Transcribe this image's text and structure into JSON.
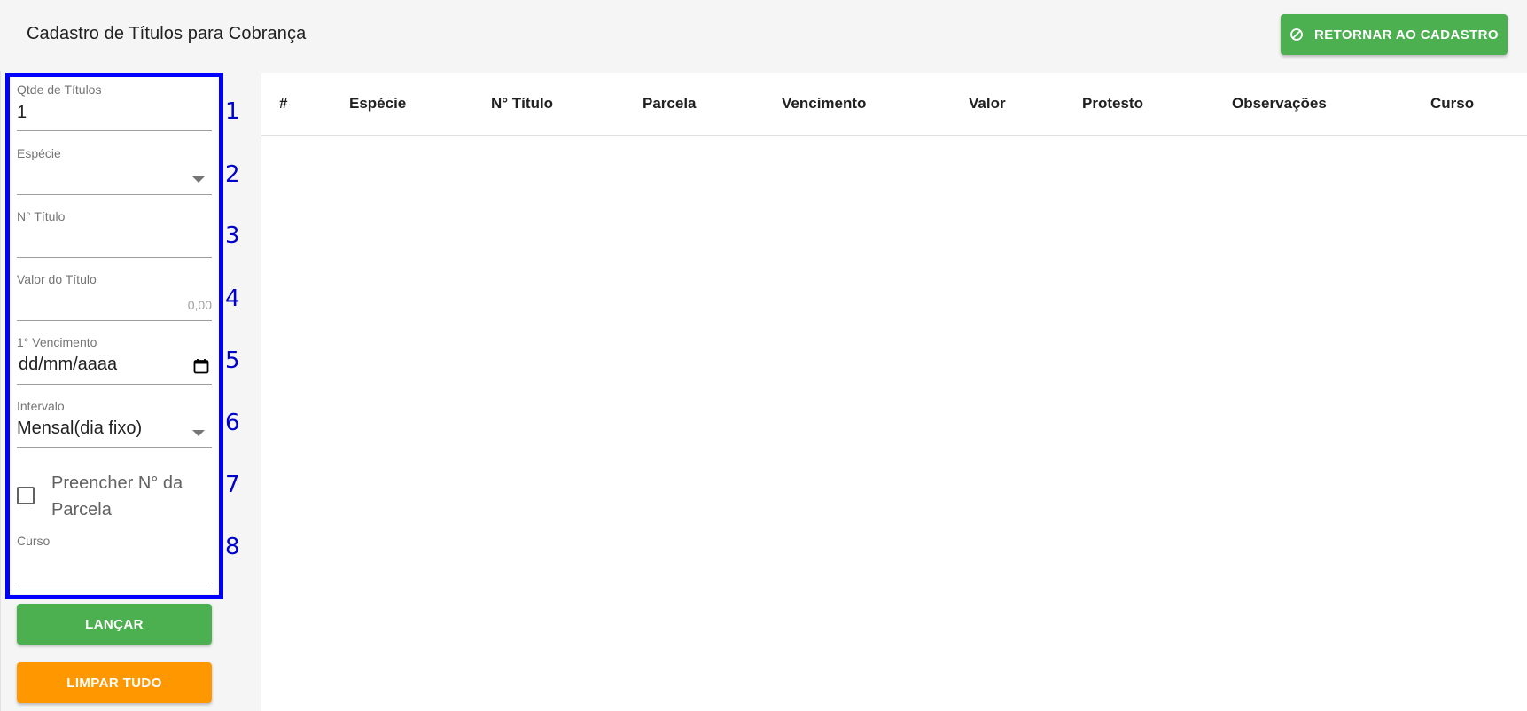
{
  "header": {
    "title": "Cadastro de Títulos para Cobrança",
    "return_button_label": "RETORNAR AO CADASTRO",
    "return_button_icon": "cancel-circle-icon"
  },
  "form": {
    "qtde": {
      "label": "Qtde de Títulos",
      "value": "1",
      "number": "1"
    },
    "especie": {
      "label": "Espécie",
      "value": "",
      "number": "2"
    },
    "numero_titulo": {
      "label": "N° Título",
      "value": "",
      "number": "3"
    },
    "valor": {
      "label": "Valor do Título",
      "placeholder": "0,00",
      "number": "4"
    },
    "vencimento": {
      "label": "1° Vencimento",
      "value": "dd/mm/aaaa",
      "number": "5"
    },
    "intervalo": {
      "label": "Intervalo",
      "value": "Mensal(dia fixo)",
      "number": "6"
    },
    "preencher": {
      "label": "Preencher N° da Parcela",
      "checked": false,
      "number": "7"
    },
    "curso": {
      "label": "Curso",
      "value": "",
      "number": "8"
    }
  },
  "buttons": {
    "launch": "LANÇAR",
    "clear": "LIMPAR TUDO"
  },
  "table": {
    "columns": [
      "#",
      "Espécie",
      "N° Título",
      "Parcela",
      "Vencimento",
      "Valor",
      "Protesto",
      "Observações",
      "Curso"
    ],
    "rows": []
  },
  "colors": {
    "primary_green": "#4caf50",
    "warning_orange": "#ff9800",
    "highlight_blue": "#0000ff"
  }
}
